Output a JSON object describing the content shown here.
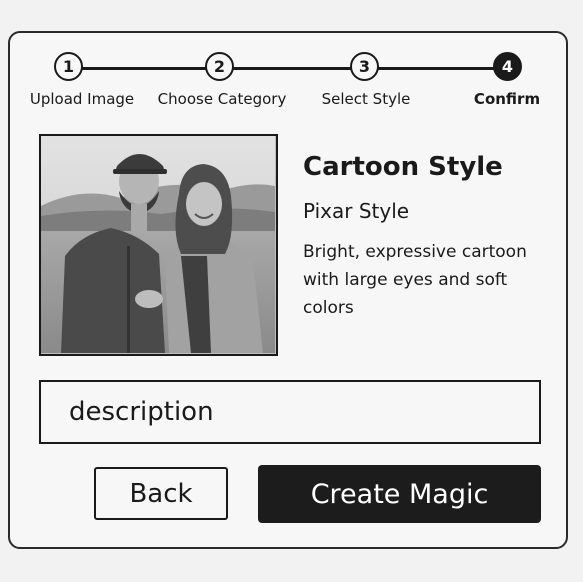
{
  "stepper": {
    "steps": [
      {
        "number": "1",
        "label": "Upload Image",
        "state": "done"
      },
      {
        "number": "2",
        "label": "Choose Category",
        "state": "done"
      },
      {
        "number": "3",
        "label": "Select Style",
        "state": "done"
      },
      {
        "number": "4",
        "label": "Confirm",
        "state": "active"
      }
    ]
  },
  "preview": {
    "image_subject": "couple-photo"
  },
  "style": {
    "title": "Cartoon Style",
    "subtitle": "Pixar Style",
    "description": "Bright, expressive cartoon with large eyes and soft colors"
  },
  "description_input": {
    "placeholder": "description",
    "value": ""
  },
  "actions": {
    "back_label": "Back",
    "create_label": "Create Magic"
  },
  "colors": {
    "primary": "#1c1c1c",
    "background": "#f7f7f7",
    "border": "#1a1a1a"
  }
}
